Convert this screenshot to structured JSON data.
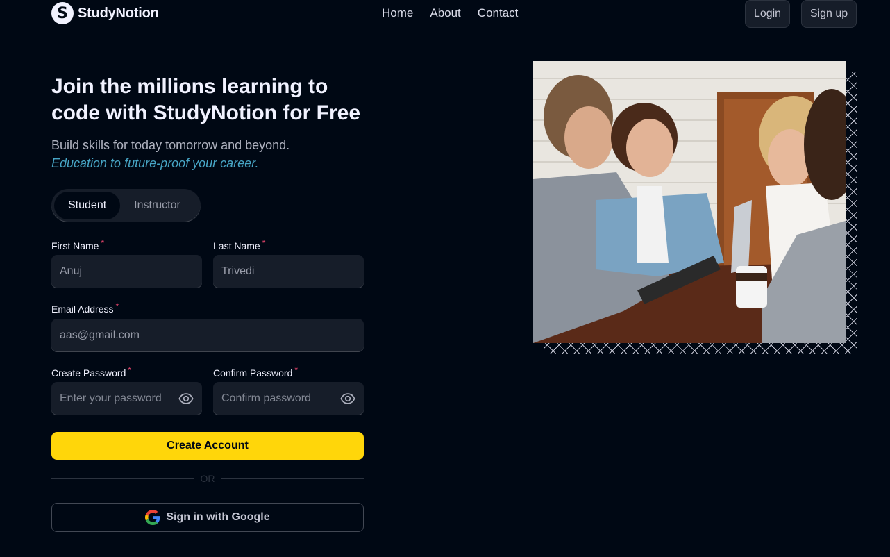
{
  "navbar": {
    "logo_letter": "S",
    "logo_text": "StudyNotion",
    "links": [
      "Home",
      "About",
      "Contact"
    ],
    "login_label": "Login",
    "signup_label": "Sign up"
  },
  "hero": {
    "heading": "Join the millions learning to code with StudyNotion for Free",
    "sub_line": "Build skills for today tomorrow and beyond.",
    "sub_highlight": "Education to future-proof your career."
  },
  "account_type": {
    "options": [
      "Student",
      "Instructor"
    ],
    "selected": "Student"
  },
  "form": {
    "first_name_label": "First Name",
    "first_name_value": "Anuj",
    "last_name_label": "Last Name",
    "last_name_value": "Trivedi",
    "email_label": "Email Address",
    "email_value": "aas@gmail.com",
    "password_label": "Create Password",
    "password_placeholder": "Enter your password",
    "confirm_label": "Confirm Password",
    "confirm_placeholder": "Confirm password",
    "required_mark": "*",
    "submit_label": "Create Account",
    "or_text": "OR",
    "google_label": "Sign in with Google"
  },
  "colors": {
    "background": "#000814",
    "accent": "#FFD60A",
    "highlight": "#47A5C5",
    "required": "#EF476F"
  },
  "icons": [
    "eye-icon",
    "google-icon"
  ]
}
